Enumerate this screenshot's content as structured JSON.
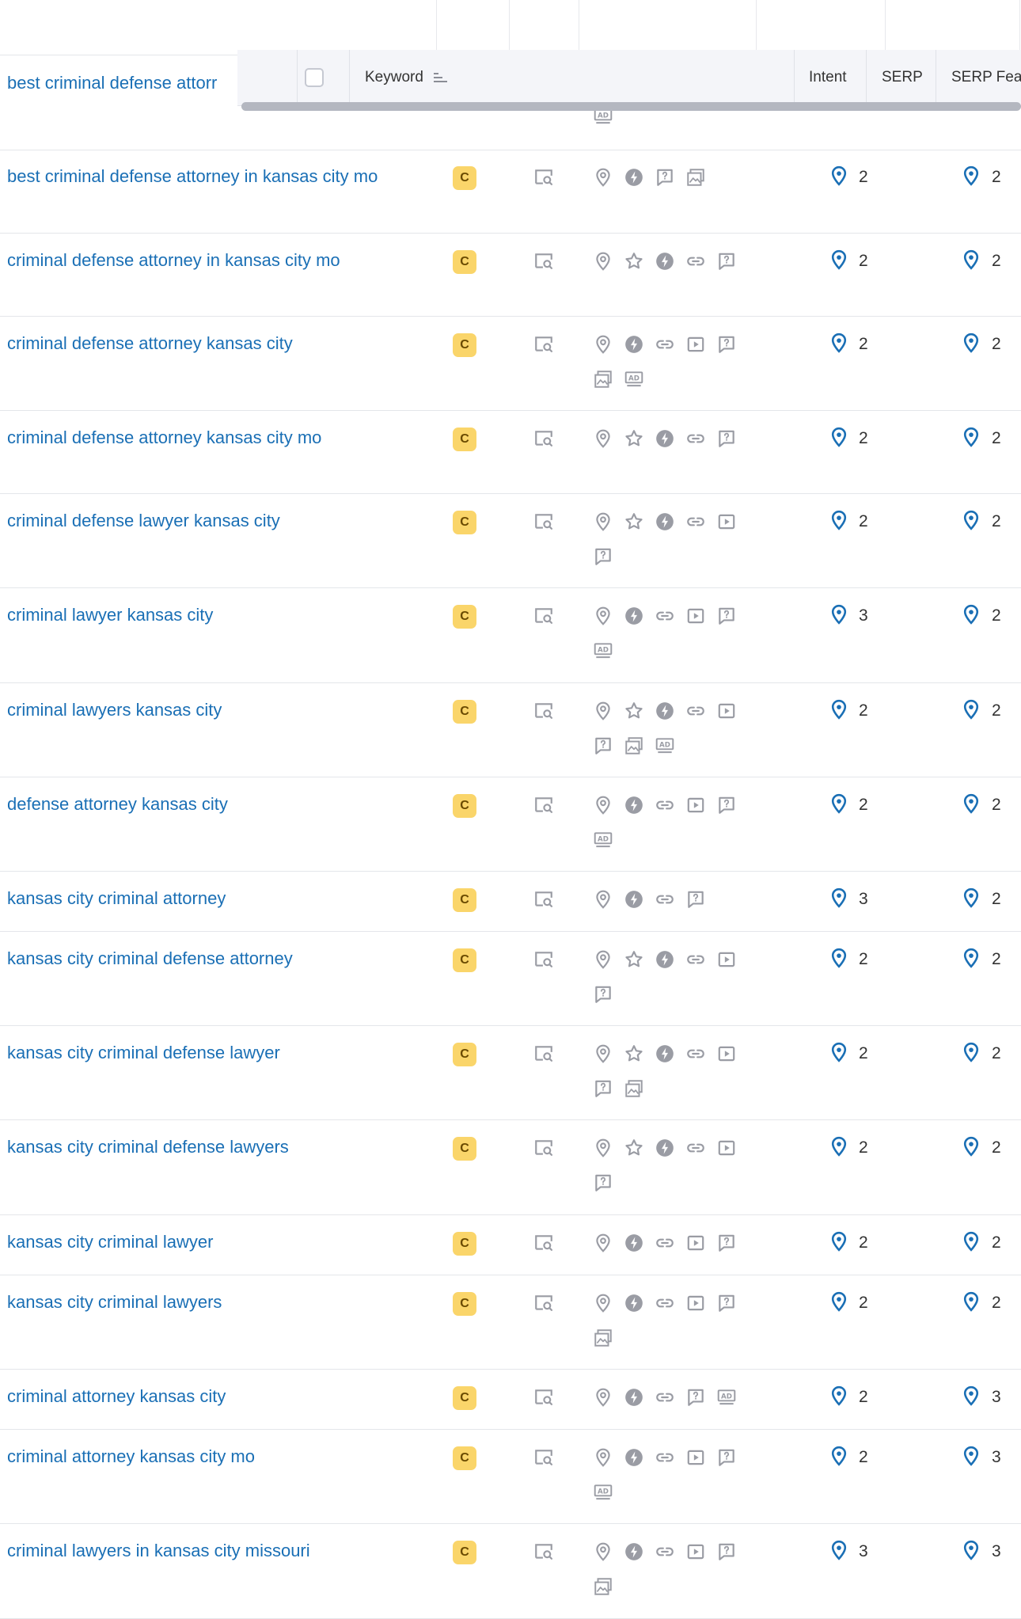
{
  "header": {
    "keyword_label": "Keyword",
    "intent_label": "Intent",
    "serp_label": "SERP",
    "serp_features_label": "SERP Fea"
  },
  "first_row_keyword": "best criminal defense attorr",
  "colors": {
    "link": "#1a6fb5",
    "badge_bg": "#fad56a",
    "icon_gray": "#9a9ca4",
    "pin_blue": "#1a6fb5"
  },
  "rows": [
    {
      "keyword": "best criminal defense attorney in kansas city mo",
      "badge": "C",
      "features": [
        [
          "pin",
          "bolt",
          "chat",
          "image"
        ]
      ],
      "intent_num": "2",
      "serp_num": "2"
    },
    {
      "keyword": "criminal defense attorney in kansas city mo",
      "badge": "C",
      "features": [
        [
          "pin",
          "star",
          "bolt",
          "link",
          "chat"
        ]
      ],
      "intent_num": "2",
      "serp_num": "2"
    },
    {
      "keyword": "criminal defense attorney kansas city",
      "badge": "C",
      "features": [
        [
          "pin",
          "bolt",
          "link",
          "video",
          "chat"
        ],
        [
          "image",
          "ad"
        ]
      ],
      "intent_num": "2",
      "serp_num": "2"
    },
    {
      "keyword": "criminal defense attorney kansas city mo",
      "badge": "C",
      "features": [
        [
          "pin",
          "star",
          "bolt",
          "link",
          "chat"
        ]
      ],
      "intent_num": "2",
      "serp_num": "2"
    },
    {
      "keyword": "criminal defense lawyer kansas city",
      "badge": "C",
      "features": [
        [
          "pin",
          "star",
          "bolt",
          "link",
          "video"
        ],
        [
          "chat"
        ]
      ],
      "intent_num": "2",
      "serp_num": "2"
    },
    {
      "keyword": "criminal lawyer kansas city",
      "badge": "C",
      "features": [
        [
          "pin",
          "bolt",
          "link",
          "video",
          "chat"
        ],
        [
          "ad"
        ]
      ],
      "intent_num": "3",
      "serp_num": "2"
    },
    {
      "keyword": "criminal lawyers kansas city",
      "badge": "C",
      "features": [
        [
          "pin",
          "star",
          "bolt",
          "link",
          "video"
        ],
        [
          "chat",
          "image",
          "ad"
        ]
      ],
      "intent_num": "2",
      "serp_num": "2"
    },
    {
      "keyword": "defense attorney kansas city",
      "badge": "C",
      "features": [
        [
          "pin",
          "bolt",
          "link",
          "video",
          "chat"
        ],
        [
          "ad"
        ]
      ],
      "intent_num": "2",
      "serp_num": "2"
    },
    {
      "keyword": "kansas city criminal attorney",
      "badge": "C",
      "features": [
        [
          "pin",
          "bolt",
          "link",
          "chat"
        ]
      ],
      "intent_num": "3",
      "serp_num": "2"
    },
    {
      "keyword": "kansas city criminal defense attorney",
      "badge": "C",
      "features": [
        [
          "pin",
          "star",
          "bolt",
          "link",
          "video"
        ],
        [
          "chat"
        ]
      ],
      "intent_num": "2",
      "serp_num": "2"
    },
    {
      "keyword": "kansas city criminal defense lawyer",
      "badge": "C",
      "features": [
        [
          "pin",
          "star",
          "bolt",
          "link",
          "video"
        ],
        [
          "chat",
          "image"
        ]
      ],
      "intent_num": "2",
      "serp_num": "2"
    },
    {
      "keyword": "kansas city criminal defense lawyers",
      "badge": "C",
      "features": [
        [
          "pin",
          "star",
          "bolt",
          "link",
          "video"
        ],
        [
          "chat"
        ]
      ],
      "intent_num": "2",
      "serp_num": "2"
    },
    {
      "keyword": "kansas city criminal lawyer",
      "badge": "C",
      "features": [
        [
          "pin",
          "bolt",
          "link",
          "video",
          "chat"
        ]
      ],
      "intent_num": "2",
      "serp_num": "2"
    },
    {
      "keyword": "kansas city criminal lawyers",
      "badge": "C",
      "features": [
        [
          "pin",
          "bolt",
          "link",
          "video",
          "chat"
        ],
        [
          "image"
        ]
      ],
      "intent_num": "2",
      "serp_num": "2"
    },
    {
      "keyword": "criminal attorney kansas city",
      "badge": "C",
      "features": [
        [
          "pin",
          "bolt",
          "link",
          "chat",
          "ad"
        ]
      ],
      "intent_num": "2",
      "serp_num": "3"
    },
    {
      "keyword": "criminal attorney kansas city mo",
      "badge": "C",
      "features": [
        [
          "pin",
          "bolt",
          "link",
          "video",
          "chat"
        ],
        [
          "ad"
        ]
      ],
      "intent_num": "2",
      "serp_num": "3"
    },
    {
      "keyword": "criminal lawyers in kansas city missouri",
      "badge": "C",
      "features": [
        [
          "pin",
          "bolt",
          "link",
          "video",
          "chat"
        ],
        [
          "image"
        ]
      ],
      "intent_num": "3",
      "serp_num": "3"
    }
  ]
}
